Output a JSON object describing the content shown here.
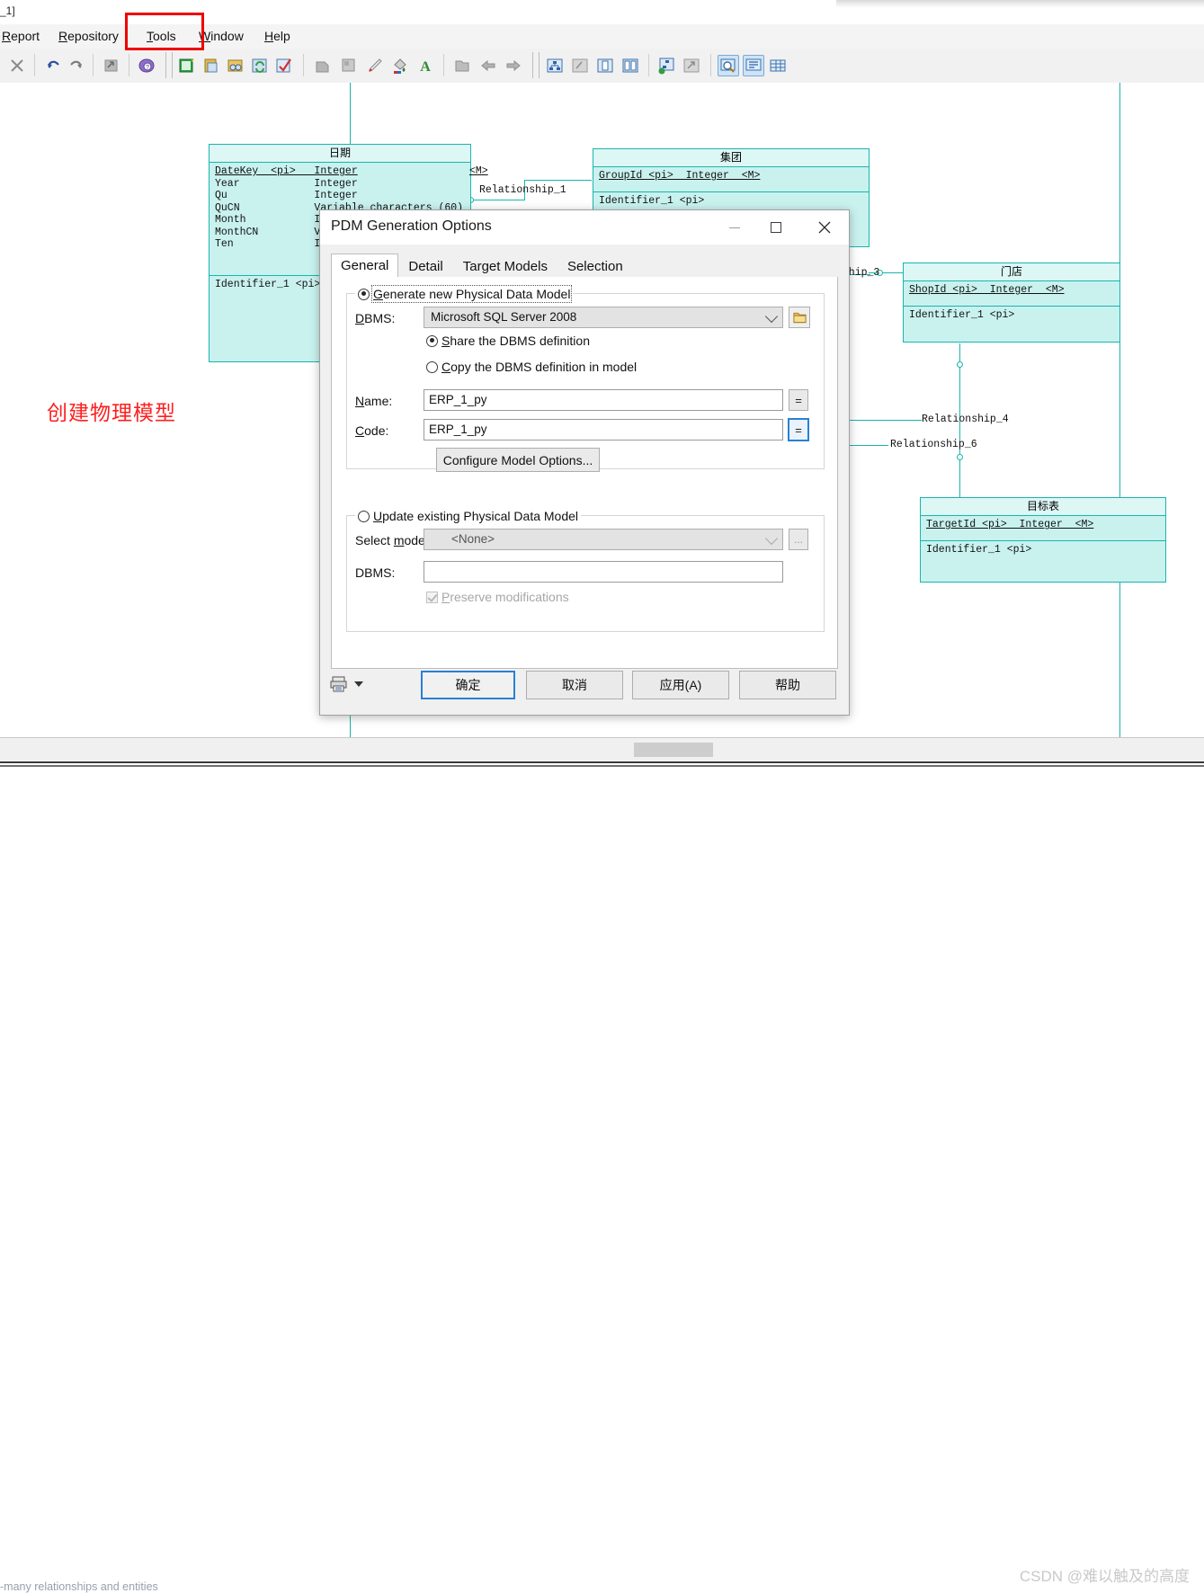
{
  "window": {
    "title_fragment": "_1]"
  },
  "menubar": {
    "items": [
      {
        "label": "Report",
        "accel": "R"
      },
      {
        "label": "Repository",
        "accel": "R"
      },
      {
        "label": "Tools",
        "accel": "T"
      },
      {
        "label": "Window",
        "accel": "W"
      },
      {
        "label": "Help",
        "accel": "H"
      }
    ],
    "highlighted_item": "Tools",
    "highlight_color": "#ef0000"
  },
  "toolbar": {
    "icons": [
      "close-icon",
      "undo-icon",
      "redo-icon",
      "export-icon",
      "help-book-icon",
      "new-model-icon",
      "paste-model-icon",
      "find-model-icon",
      "refresh-icon",
      "check-model-icon",
      "copy-shape-icon",
      "frame-icon",
      "brush-icon",
      "fill-color-icon",
      "font-color-icon",
      "folder-shape-icon",
      "prev-arrow-icon",
      "next-arrow-icon",
      "diagram-tree-icon",
      "gray-diagram-icon",
      "page-icon",
      "two-page-icon",
      "link-diagram-icon",
      "gray-arrow-icon",
      "zoom-preview-icon",
      "comment-icon",
      "grid-icon"
    ]
  },
  "canvas": {
    "note": "创建物理模型",
    "note_color": "#fd2020",
    "entities": [
      {
        "name": "日期",
        "attributes": [
          "DateKey  <pi>   Integer                    <M>",
          "Year            Integer",
          "Qu              Integer",
          "QuCN            Variable characters (60)",
          "Month           Integer",
          "MonthCN         Variable characters (60)",
          "Ten             Integer"
        ],
        "identifier": "Identifier_1 <pi>"
      },
      {
        "name": "集团",
        "attributes": [
          "GroupId <pi>  Integer  <M>"
        ],
        "identifier": "Identifier_1 <pi>"
      },
      {
        "name": "门店",
        "attributes": [
          "ShopId <pi>  Integer  <M>"
        ],
        "identifier": "Identifier_1 <pi>"
      },
      {
        "name": "目标表",
        "attributes": [
          "TargetId <pi>  Integer  <M>"
        ],
        "identifier": "Identifier_1 <pi>"
      }
    ],
    "relationships": [
      "Relationship_1",
      "nship_3",
      "Relationship_4",
      "Relationship_6"
    ]
  },
  "dialog": {
    "title": "PDM Generation Options",
    "window_buttons": [
      "minimize-button",
      "maximize-button",
      "close-button"
    ],
    "tabs": [
      {
        "label": "General",
        "active": true
      },
      {
        "label": "Detail",
        "active": false
      },
      {
        "label": "Target Models",
        "active": false
      },
      {
        "label": "Selection",
        "active": false
      }
    ],
    "generate_group": {
      "radio_label": "Generate new Physical Data Model",
      "radio_selected": true,
      "dbms_label": "DBMS:",
      "dbms_value": "Microsoft SQL Server 2008",
      "folder_button": "folder-open-icon",
      "share_option": "Share the DBMS definition",
      "share_selected": true,
      "copy_option": "Copy the DBMS definition in model",
      "copy_selected": false,
      "name_label": "Name:",
      "name_value": "ERP_1_py",
      "name_equals_button": "=",
      "code_label": "Code:",
      "code_value": "ERP_1_py",
      "code_equals_button": "=",
      "configure_button": "Configure Model Options..."
    },
    "update_group": {
      "radio_label": "Update existing Physical Data Model",
      "radio_selected": false,
      "select_model_label": "Select model:",
      "select_model_value": "<None>",
      "browse_button": "...",
      "dbms_label": "DBMS:",
      "dbms_value": "",
      "preserve_label": "Preserve modifications",
      "preserve_checked": true
    },
    "footer": {
      "print_icon": "print-icon",
      "print_caret": "caret-down-icon",
      "buttons": [
        {
          "label": "确定",
          "primary": true
        },
        {
          "label": "取消",
          "primary": false
        },
        {
          "label": "应用(A)",
          "primary": false
        },
        {
          "label": "帮助",
          "primary": false
        }
      ]
    }
  },
  "statusbar": {
    "text": "-many relationships and entities"
  },
  "watermark": {
    "text": "CSDN @难以触及的高度"
  }
}
